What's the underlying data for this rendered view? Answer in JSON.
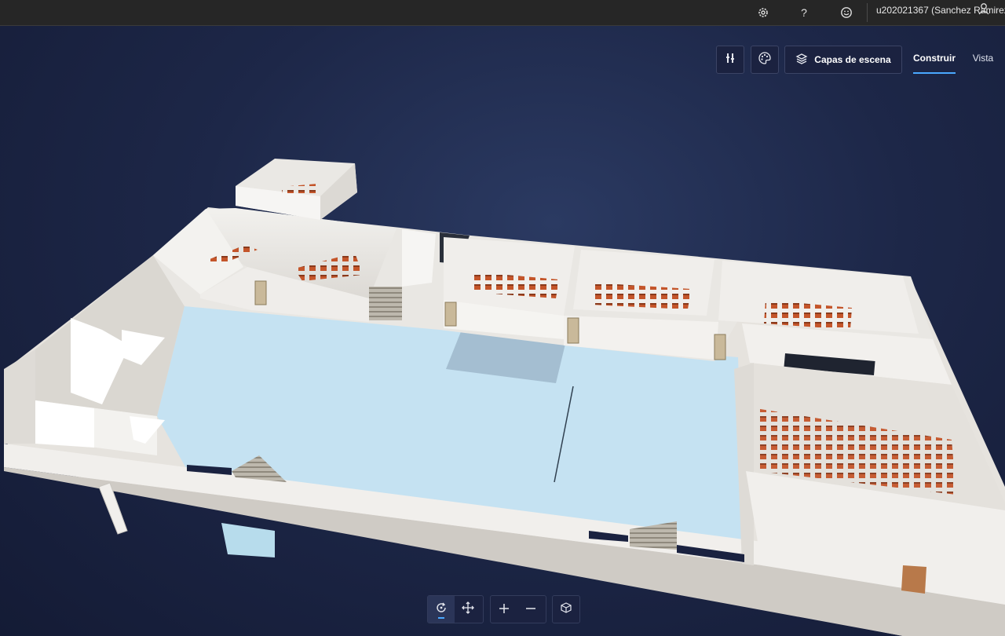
{
  "header": {
    "icons": [
      "gear-icon",
      "help-icon",
      "feedback-smiley-icon"
    ],
    "user_name": "u202021367 (Sanchez Ramirez",
    "user_icon": "person-icon"
  },
  "toolbar": {
    "tools_icon": "tools-icon",
    "palette_icon": "palette-icon",
    "layers_label": "Capas de escena",
    "layers_icon": "layers-icon",
    "tabs": [
      {
        "label": "Construir",
        "active": true
      },
      {
        "label": "Vista",
        "active": false
      }
    ]
  },
  "navigation": {
    "buttons": [
      "orbit-icon",
      "pan-icon",
      "zoom-in-icon",
      "zoom-out-icon",
      "cube-view-icon"
    ],
    "active": "orbit-icon"
  },
  "colors": {
    "background": "#1d2748",
    "floor": "#c5e2f2",
    "wall": "#eae8e4",
    "seat": "#c4552a",
    "accent": "#4aa8ff"
  }
}
